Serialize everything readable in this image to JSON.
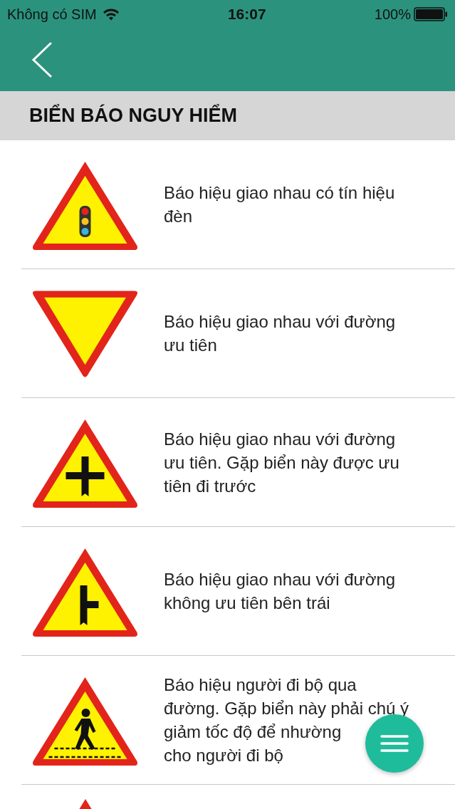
{
  "status_bar": {
    "carrier": "Không có SIM",
    "time": "16:07",
    "battery": "100%"
  },
  "section": {
    "title": "BIỂN BÁO NGUY HIỂM"
  },
  "signs": [
    {
      "kind": "traffic-signal",
      "lines": [
        "Báo hiệu giao nhau có tín hiệu",
        "đèn"
      ]
    },
    {
      "kind": "yield",
      "lines": [
        "Báo hiệu giao nhau với đường",
        "ưu tiên"
      ]
    },
    {
      "kind": "crossroad",
      "lines": [
        "Báo hiệu giao nhau với đường",
        "ưu tiên. Gặp biển này được ưu",
        "tiên đi trước"
      ]
    },
    {
      "kind": "side-road",
      "lines": [
        "Báo hiệu giao nhau với đường",
        "không ưu tiên bên trái"
      ]
    },
    {
      "kind": "pedestrian",
      "lines": [
        "Báo hiệu người đi bộ qua",
        "đường. Gặp biển này phải chú ý",
        "giảm tốc độ để nhường",
        "cho người đi bộ"
      ]
    },
    {
      "kind": "partial"
    }
  ]
}
